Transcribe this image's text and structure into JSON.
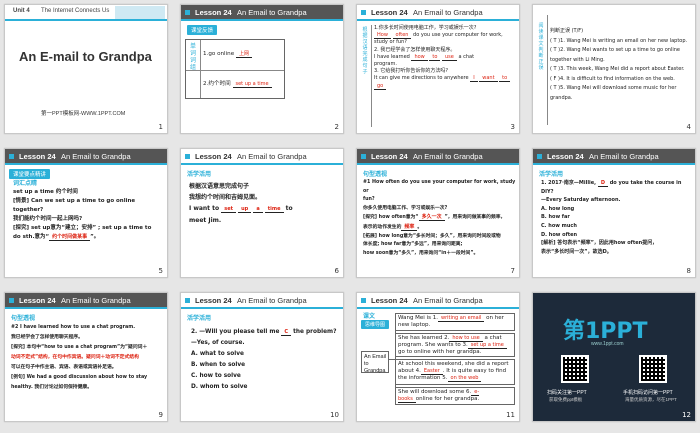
{
  "slides": [
    {
      "num": "1",
      "unit": "Unit 4",
      "unit_title": "The Internet Connects Us",
      "title": "An E-mail to Grandpa",
      "source": "第一PPT模板网-WWW.1PPT.COM"
    },
    {
      "num": "2",
      "lesson": "Lesson 24",
      "topic": "An Email to Grandpa",
      "tag": "课堂反馈",
      "side": [
        "单",
        "词",
        "词",
        "组"
      ],
      "lines": [
        "1.go online",
        "2.约个时间"
      ],
      "answers": [
        "上网",
        "set up a time"
      ]
    },
    {
      "num": "3",
      "lesson": "Lesson 24",
      "topic": "An Email to Grandpa",
      "side": [
        "根",
        "据",
        "汉",
        "语",
        "完",
        "成",
        "句",
        "子"
      ],
      "lines": [
        "1.你多长时间使用电脑工作，学习或娱乐一次?",
        "do you use your computer for work,",
        "study or fun?",
        "2. 我已经学会了怎样使用聊天程序。",
        "I have learned",
        "a chat",
        "program.",
        "3. 它给我打听你告诉你的方法吗?",
        "It can give me directions to anywhere"
      ],
      "answers": [
        "How",
        "often",
        "how",
        "to",
        "use",
        "I",
        "want",
        "to",
        "go"
      ]
    },
    {
      "num": "4",
      "side": [
        "阅",
        "读",
        "课",
        "文",
        "判",
        "断",
        "正",
        "误"
      ],
      "lines": [
        "判断正误 (T/F)",
        "( T )1. Wang Mei is writing an email on her new laptop.",
        "( T )2. Wang Mei wants to set up a time to go online",
        "together with Li Ming.",
        "( T )3. This week, Wang Mei did a report about Easter.",
        "( F )4. It is difficult to find information on the web.",
        "( T )5. Wang Mei will download some music for her",
        "grandpa."
      ]
    },
    {
      "num": "5",
      "lesson": "Lesson 24",
      "topic": "An Email to Grandpa",
      "tag": "课堂要点精讲",
      "lines": [
        "词汇点睛",
        "set up a time 约个时间",
        "[情景] Can we set up a time to go online together?",
        "我们能约个时间一起上网吗?",
        "[探究] set up意为“建立；安排” ; set up a time to",
        "do sth.意为“",
        "”。"
      ],
      "answer": "约个时间做某事"
    },
    {
      "num": "6",
      "lesson": "Lesson 24",
      "topic": "An Email to Grandpa",
      "tag": "活学活用",
      "lines": [
        "根据汉语意思完成句子",
        "我想约个时间和吉姆见面。",
        "I want to",
        "up",
        "a",
        "time",
        "to",
        "meet Jim."
      ],
      "answers": [
        "set"
      ]
    },
    {
      "num": "7",
      "lesson": "Lesson 24",
      "topic": "An Email to Grandpa",
      "tag": "句型透视",
      "lines": [
        "#1 How often do you use your computer for work, study or",
        "fun?",
        "你多久使用电脑工作、学习或娱乐一次?",
        "[探究] how often意为“",
        "”，用来询问做某事的频率，",
        "表示的动作发生的",
        "。",
        "[拓展] how long意为“多长时间；多久”，用来询问时间段或物",
        "体长度; how far意为“多远”，用来询问距离;",
        "how soon意为“多久”，用来询问“in＋一段时间”。"
      ],
      "answers": [
        "多久一次",
        "频率"
      ]
    },
    {
      "num": "8",
      "lesson": "Lesson 24",
      "topic": "An Email to Grandpa",
      "tag": "活学活用",
      "lines": [
        "1. 2017·南京—Millie,",
        "do you take the course in",
        "DIY?",
        "—Every Saturday afternoon.",
        "A. how long",
        "B. how far",
        "C. how much",
        "D. how often",
        "[解析] 答句表示“频率”，因此用how often提问，",
        "表示“多长时间一次”，故选D。"
      ],
      "answer": "D"
    },
    {
      "num": "9",
      "lesson": "Lesson 24",
      "topic": "An Email to Grandpa",
      "tag": "句型透视",
      "lines": [
        "#2 I have learned how to use a chat program.",
        "我已经学会了怎样使用聊天程序。",
        "[探究] 本句中“how to use a chat program”为“疑问词＋",
        "动词不定式”结构，在句中作宾语。疑问词＋动词不定式结构",
        "可以在句子中作主语、宾语、表语或宾语补足语。",
        "[例句] We had a good discussion about how to stay",
        "healthy. 我们讨论过如何保持健康。"
      ]
    },
    {
      "num": "10",
      "lesson": "Lesson 24",
      "topic": "An Email to Grandpa",
      "tag": "活学活用",
      "lines": [
        "2. —Will you please tell me",
        "the problem?",
        "—Yes, of course.",
        "A. what to solve",
        "B. when to solve",
        "C. how to solve",
        "D. whom to solve"
      ],
      "answer": "C"
    },
    {
      "num": "11",
      "lesson": "Lesson 24",
      "topic": "An Email to Grandpa",
      "tag": "课文",
      "tag_sub": "思维导图",
      "center": "An Email to Grandpa",
      "lines": [
        "Wang Mei is 1.",
        "on her new laptop.",
        "She has learned 2.",
        "a chat program. She wants to 3.",
        "go to online with her grandpa.",
        "At school this weekend, she did a report about 4.",
        ". It is quite easy to find the information 5.",
        "She will download some 6.",
        "online for her grandpa."
      ],
      "answers": [
        "writing an email",
        "how to use",
        "set up a time",
        "Easter",
        "on the web",
        "e-books"
      ]
    },
    {
      "num": "12",
      "brand": "第1PPT",
      "brand_url": "www.1ppt.com",
      "left_caption": "扫码关注第一PPT",
      "left_sub": "获取免费ppt模板",
      "right_caption": "手机扫码访问第一PPT",
      "right_sub": "海量优质资源，尽在1PPT"
    }
  ],
  "colors": {
    "accent": "#2bb0d8",
    "answer": "#dd2211",
    "dark_header": "#555555"
  }
}
